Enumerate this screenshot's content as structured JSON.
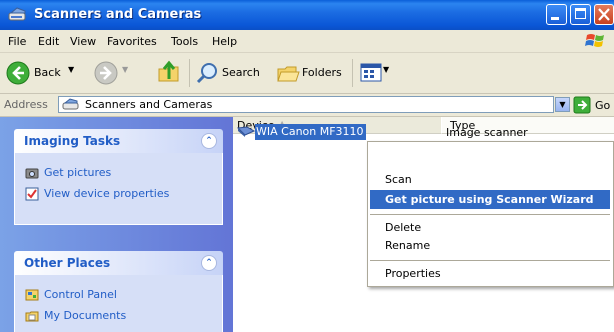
{
  "window": {
    "title": "Scanners and Cameras"
  },
  "menubar": {
    "items": [
      "File",
      "Edit",
      "View",
      "Favorites",
      "Tools",
      "Help"
    ]
  },
  "toolbar": {
    "back_label": "Back",
    "search_label": "Search",
    "folders_label": "Folders"
  },
  "address": {
    "label": "Address",
    "value": "Scanners and Cameras",
    "go_label": "Go"
  },
  "taskpane": {
    "imaging": {
      "title": "Imaging Tasks",
      "items": [
        "Get pictures",
        "View device properties"
      ]
    },
    "other": {
      "title": "Other Places",
      "items": [
        "Control Panel",
        "My Documents"
      ]
    }
  },
  "list": {
    "columns": [
      "Device",
      "Type"
    ],
    "rows": [
      {
        "device": "WIA Canon MF3110",
        "type": "Image scanner"
      }
    ]
  },
  "context_menu": {
    "items": [
      "Scan",
      "Get picture using Scanner Wizard",
      "Delete",
      "Rename",
      "Properties"
    ],
    "highlighted": "Get picture using Scanner Wizard"
  },
  "colors": {
    "title_bar": "#0a5fd9",
    "selection": "#316ac5",
    "task_link": "#215dc6"
  }
}
